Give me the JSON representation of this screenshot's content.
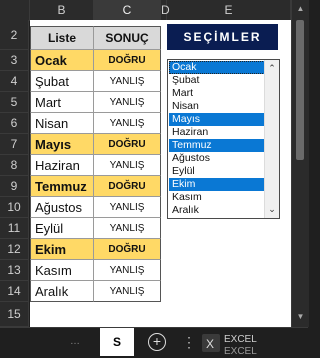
{
  "columns": {
    "b": "B",
    "c": "C",
    "d": "D",
    "e": "E"
  },
  "rows": [
    "2",
    "3",
    "4",
    "5",
    "6",
    "7",
    "8",
    "9",
    "10",
    "11",
    "12",
    "13",
    "14",
    "15"
  ],
  "table": {
    "header_liste": "Liste",
    "header_sonuc": "SONUÇ",
    "items": [
      {
        "month": "Ocak",
        "result": "DOĞRU"
      },
      {
        "month": "Şubat",
        "result": "YANLIŞ"
      },
      {
        "month": "Mart",
        "result": "YANLIŞ"
      },
      {
        "month": "Nisan",
        "result": "YANLIŞ"
      },
      {
        "month": "Mayıs",
        "result": "DOĞRU"
      },
      {
        "month": "Haziran",
        "result": "YANLIŞ"
      },
      {
        "month": "Temmuz",
        "result": "DOĞRU"
      },
      {
        "month": "Ağustos",
        "result": "YANLIŞ"
      },
      {
        "month": "Eylül",
        "result": "YANLIŞ"
      },
      {
        "month": "Ekim",
        "result": "DOĞRU"
      },
      {
        "month": "Kasım",
        "result": "YANLIŞ"
      },
      {
        "month": "Aralık",
        "result": "YANLIŞ"
      }
    ]
  },
  "selection_title": "SEÇİMLER",
  "listbox": {
    "items": [
      "Ocak",
      "Şubat",
      "Mart",
      "Nisan",
      "Mayıs",
      "Haziran",
      "Temmuz",
      "Ağustos",
      "Eylül",
      "Ekim",
      "Kasım",
      "Aralık"
    ],
    "selected": [
      "Ocak",
      "Mayıs",
      "Temmuz",
      "Ekim"
    ]
  },
  "tabbar": {
    "sheet_tab": "S",
    "logo_text": "EXCEL"
  },
  "colors": {
    "highlight": "#ffd966",
    "title_bg": "#0a1d52",
    "selected_bg": "#0a78d4"
  }
}
